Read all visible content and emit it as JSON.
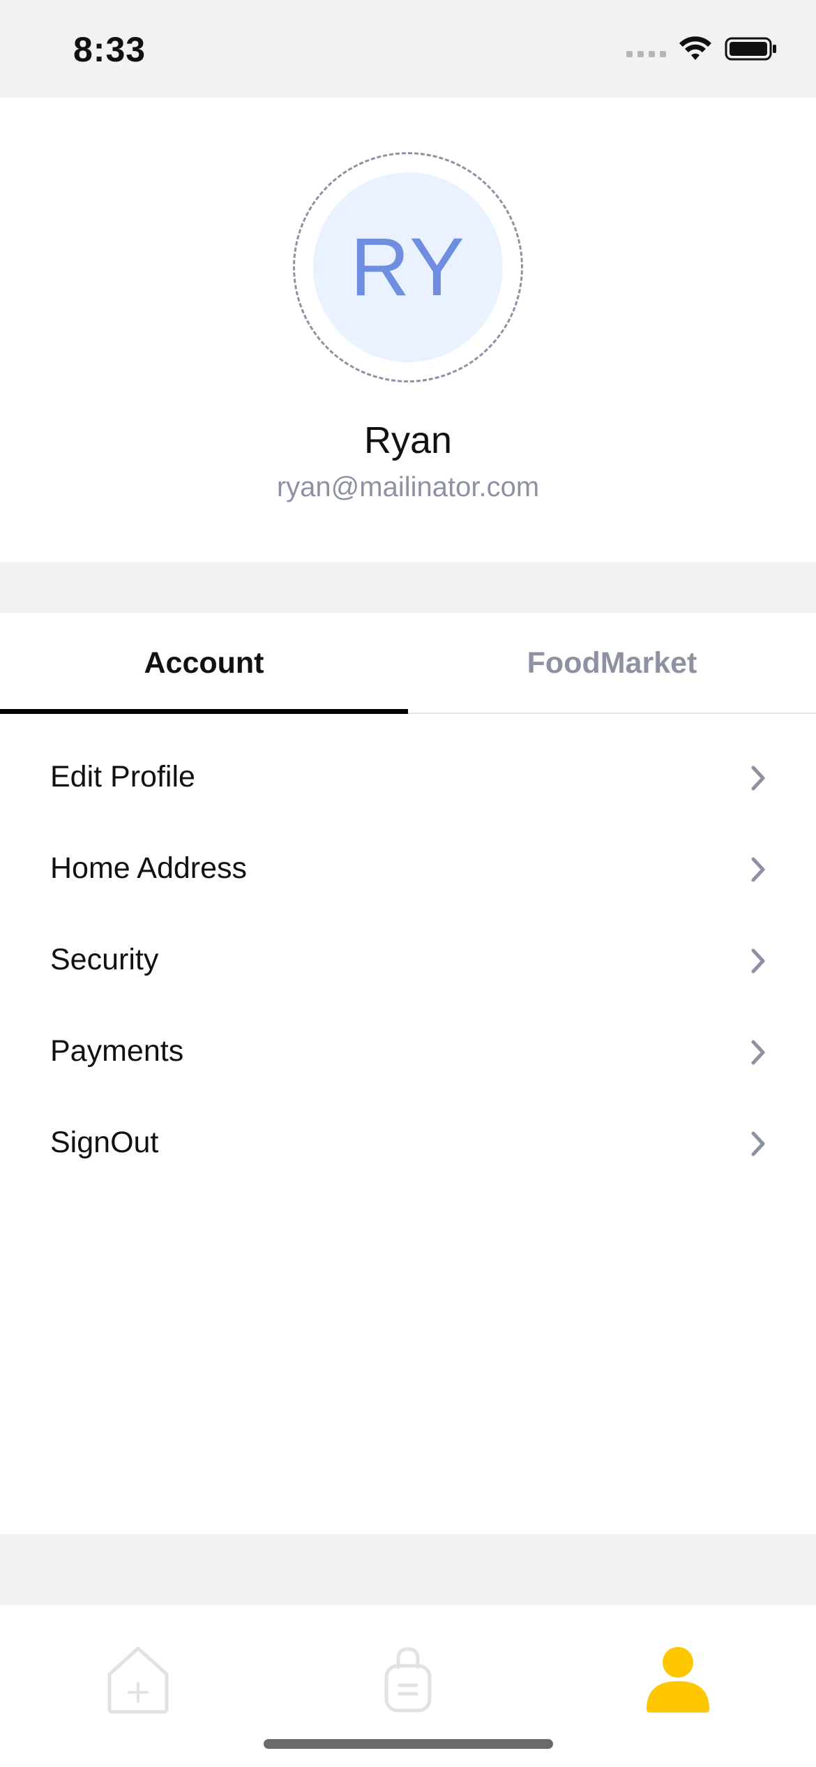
{
  "status_bar": {
    "time": "8:33",
    "icons": [
      "cellular-dots-icon",
      "wifi-icon",
      "battery-icon"
    ]
  },
  "profile": {
    "initials": "RY",
    "name": "Ryan",
    "email": "ryan@mailinator.com"
  },
  "tabs": [
    {
      "label": "Account",
      "active": true
    },
    {
      "label": "FoodMarket",
      "active": false
    }
  ],
  "menu": {
    "items": [
      {
        "label": "Edit Profile",
        "icon": "chevron-right-icon"
      },
      {
        "label": "Home Address",
        "icon": "chevron-right-icon"
      },
      {
        "label": "Security",
        "icon": "chevron-right-icon"
      },
      {
        "label": "Payments",
        "icon": "chevron-right-icon"
      },
      {
        "label": "SignOut",
        "icon": "chevron-right-icon"
      }
    ]
  },
  "bottom_nav": {
    "items": [
      {
        "icon": "home-icon",
        "active": false
      },
      {
        "icon": "shopping-bag-icon",
        "active": false
      },
      {
        "icon": "profile-icon",
        "active": true
      }
    ]
  },
  "colors": {
    "accent": "#FFC700",
    "inactive": "#8D92A3",
    "avatar_bg": "#EAF2FF",
    "avatar_text": "#6F8EE0",
    "background": "#F2F2F2"
  }
}
